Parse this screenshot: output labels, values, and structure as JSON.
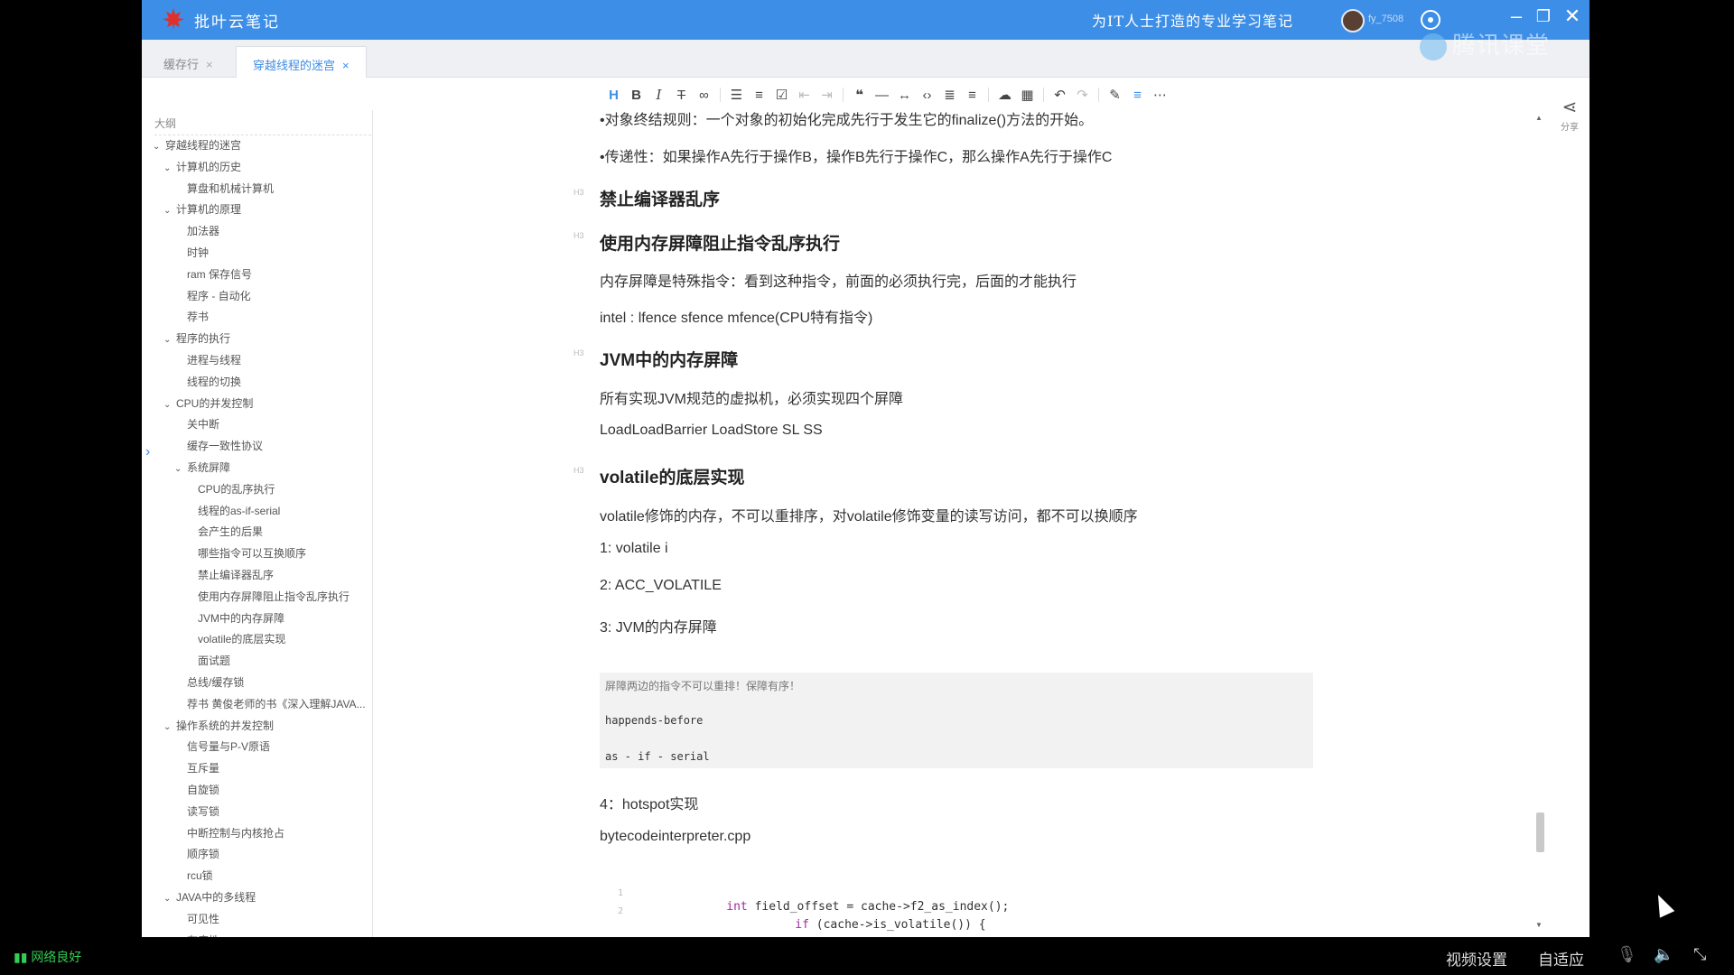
{
  "window": {
    "app_title": "批叶云笔记",
    "slogan": "为IT人士打造的专业学习笔记",
    "user_name": "fy_7508",
    "watermark": "腾讯课堂",
    "brand_color": "#3d8ee6"
  },
  "tabs": [
    {
      "label": "缓存行",
      "close": "×",
      "active": false
    },
    {
      "label": "穿越线程的迷宫",
      "close": "×",
      "active": true
    }
  ],
  "toolbar": {
    "icons": [
      "heading-icon",
      "bold-icon",
      "italic-icon",
      "strikethrough-icon",
      "link-icon",
      "bullet-list-icon",
      "numbered-list-icon",
      "checkbox-icon",
      "outdent-icon",
      "indent-icon",
      "quote-icon",
      "hr-icon",
      "code-inline-icon",
      "code-block-icon",
      "align-icon",
      "text-format-icon",
      "image-icon",
      "table-icon",
      "undo-icon",
      "redo-icon",
      "pen-icon",
      "center-icon",
      "more-icon"
    ]
  },
  "sidebar": {
    "title": "大纲",
    "items": [
      {
        "label": "穿越线程的迷宫",
        "level": 0,
        "expanded": true
      },
      {
        "label": "计算机的历史",
        "level": 1,
        "expanded": true
      },
      {
        "label": "算盘和机械计算机",
        "level": 2
      },
      {
        "label": "计算机的原理",
        "level": 1,
        "expanded": true
      },
      {
        "label": "加法器",
        "level": 2
      },
      {
        "label": "时钟",
        "level": 2
      },
      {
        "label": "ram 保存信号",
        "level": 2
      },
      {
        "label": "程序 - 自动化",
        "level": 2
      },
      {
        "label": "荐书",
        "level": 2
      },
      {
        "label": "程序的执行",
        "level": 1,
        "expanded": true
      },
      {
        "label": "进程与线程",
        "level": 2
      },
      {
        "label": "线程的切换",
        "level": 2
      },
      {
        "label": "CPU的并发控制",
        "level": 1,
        "expanded": true
      },
      {
        "label": "关中断",
        "level": 2
      },
      {
        "label": "缓存一致性协议",
        "level": 2
      },
      {
        "label": "系统屏障",
        "level": 2,
        "expanded": true
      },
      {
        "label": "CPU的乱序执行",
        "level": 3
      },
      {
        "label": "线程的as-if-serial",
        "level": 3
      },
      {
        "label": "会产生的后果",
        "level": 3
      },
      {
        "label": "哪些指令可以互换顺序",
        "level": 3
      },
      {
        "label": "禁止编译器乱序",
        "level": 3
      },
      {
        "label": "使用内存屏障阻止指令乱序执行",
        "level": 3
      },
      {
        "label": "JVM中的内存屏障",
        "level": 3
      },
      {
        "label": "volatile的底层实现",
        "level": 3
      },
      {
        "label": "面试题",
        "level": 3
      },
      {
        "label": "总线/缓存锁",
        "level": 2
      },
      {
        "label": "荐书 黄俊老师的书《深入理解JAVA...",
        "level": 2
      },
      {
        "label": "操作系统的并发控制",
        "level": 1,
        "expanded": true
      },
      {
        "label": "信号量与P-V原语",
        "level": 2
      },
      {
        "label": "互斥量",
        "level": 2
      },
      {
        "label": "自旋锁",
        "level": 2
      },
      {
        "label": "读写锁",
        "level": 2
      },
      {
        "label": "中断控制与内核抢占",
        "level": 2
      },
      {
        "label": "顺序锁",
        "level": 2
      },
      {
        "label": "rcu锁",
        "level": 2
      },
      {
        "label": "JAVA中的多线程",
        "level": 1,
        "expanded": true
      },
      {
        "label": "可见性",
        "level": 2
      },
      {
        "label": "有序性",
        "level": 2
      }
    ]
  },
  "content": {
    "line_finalize": "•对象终结规则：一个对象的初始化完成先行于发生它的finalize()方法的开始。",
    "line_transitive": "•传递性：如果操作A先行于操作B，操作B先行于操作C，那么操作A先行于操作C",
    "h_compiler": "禁止编译器乱序",
    "h_barrier": "使用内存屏障阻止指令乱序执行",
    "p_barrier": "内存屏障是特殊指令：看到这种指令，前面的必须执行完，后面的才能执行",
    "p_intel": "intel : lfence sfence mfence(CPU特有指令)",
    "h_jvm": "JVM中的内存屏障",
    "p_jvm": "所有实现JVM规范的虚拟机，必须实现四个屏障",
    "p_barriers": "LoadLoadBarrier  LoadStore SL SS",
    "h_volatile": "volatile的底层实现",
    "p_volatile": "volatile修饰的内存，不可以重排序，对volatile修饰变量的读写访问，都不可以换顺序",
    "p_1": "1: volatile i",
    "p_2": "2: ACC_VOLATILE",
    "p_3": "3: JVM的内存屏障",
    "quote_1": "屏障两边的指令不可以重排！保障有序！",
    "quote_2": "happends-before",
    "quote_3": "as - if - serial",
    "p_4": "4：hotspot实现",
    "p_cpp": "bytecodeinterpreter.cpp",
    "code_ln1": "1",
    "code_ln2": "2",
    "code_kw1": "int",
    "code_l1": " field_offset = cache->f2_as_index();",
    "code_kw2": "if",
    "code_l2": " (cache->is_volatile()) {",
    "share_label": "分享"
  },
  "player": {
    "network": "网络良好",
    "video_settings": "视频设置",
    "fit": "自适应"
  }
}
